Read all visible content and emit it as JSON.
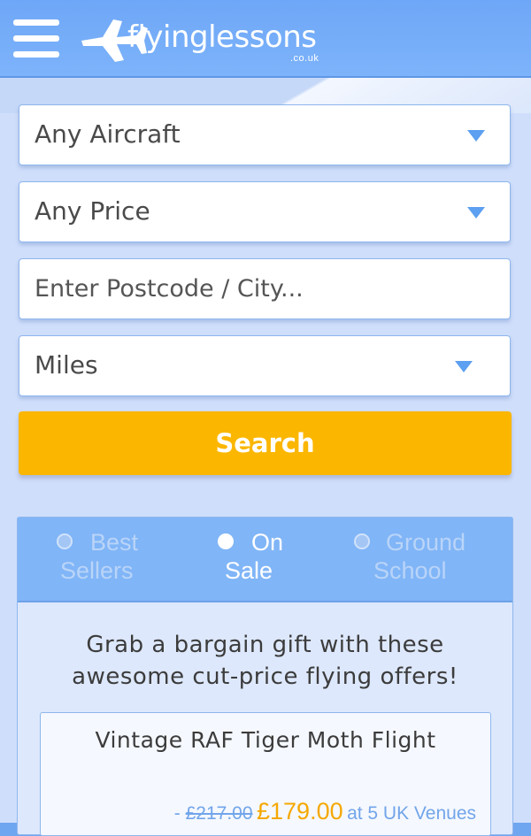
{
  "header": {
    "logo_text": "flyinglessons",
    "logo_sub": ".co.uk",
    "menu_icon": "hamburger-menu-icon",
    "logo_icon": "airplane-icon"
  },
  "search_form": {
    "aircraft": {
      "selected": "Any Aircraft"
    },
    "price": {
      "selected": "Any Price"
    },
    "location": {
      "value": "",
      "placeholder": "Enter Postcode / City..."
    },
    "distance": {
      "selected": "Miles"
    },
    "search_label": "Search"
  },
  "tabs": [
    {
      "line1": "Best",
      "line2": "Sellers",
      "active": false
    },
    {
      "line1": "On",
      "line2": "Sale",
      "active": true
    },
    {
      "line1": "Ground",
      "line2": "School",
      "active": false
    }
  ],
  "promo": {
    "line1": "Grab a bargain gift with these",
    "line2": "awesome cut-price flying offers!"
  },
  "offer": {
    "title": "Vintage RAF Tiger Moth Flight",
    "dash": "- ",
    "old_price": "£217.00",
    "new_price": "£179.00",
    "venues": "at 5 UK Venues"
  },
  "colors": {
    "header": "#7db3fa",
    "accent": "#fbb600",
    "link_blue": "#72a5ea"
  }
}
